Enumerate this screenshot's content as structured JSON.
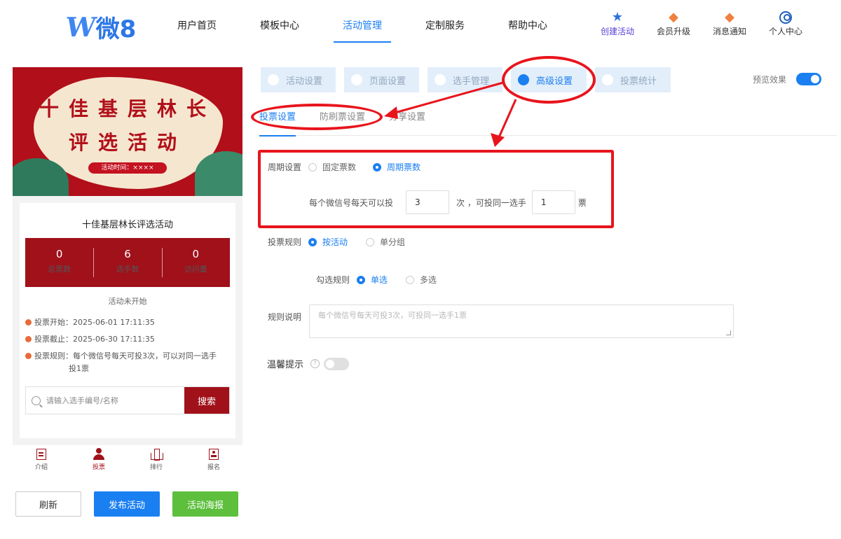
{
  "header": {
    "logo_text": "微8",
    "nav": [
      "用户首页",
      "模板中心",
      "活动管理",
      "定制服务",
      "帮助中心"
    ],
    "active_nav": "活动管理",
    "icons": [
      {
        "label": "创建活动",
        "icon": "star-icon"
      },
      {
        "label": "会员升级",
        "icon": "shield-icon"
      },
      {
        "label": "消息通知",
        "icon": "bell-shield-icon"
      },
      {
        "label": "个人中心",
        "icon": "user-icon"
      }
    ]
  },
  "preview": {
    "banner": {
      "line1": "十佳基层林长",
      "line2": "评选活动",
      "time": "活动时间：××××"
    },
    "title": "十佳基层林长评选活动",
    "stats": [
      {
        "value": "0",
        "label": "总票数"
      },
      {
        "value": "6",
        "label": "选手数"
      },
      {
        "value": "0",
        "label": "访问量"
      }
    ],
    "status": "活动未开始",
    "info": {
      "start": "投票开始：2025-06-01 17:11:35",
      "end": "投票截止：2025-06-30 17:11:35",
      "rule_line1": "投票规则：每个微信号每天可投3次，可以对同一选手",
      "rule_line2": "投1票"
    },
    "search_placeholder": "请输入选手编号/名称",
    "search_button": "搜索",
    "tabs": [
      "介绍",
      "投票",
      "排行",
      "报名"
    ],
    "active_tab": "投票"
  },
  "actions": {
    "refresh": "刷新",
    "publish": "发布活动",
    "poster": "活动海报"
  },
  "settings": {
    "steps": [
      "活动设置",
      "页面设置",
      "选手管理",
      "高级设置",
      "投票统计"
    ],
    "active_step": "高级设置",
    "preview_label": "预览效果",
    "preview_on": true,
    "subtabs": [
      "投票设置",
      "防刷票设置",
      "分享设置"
    ],
    "active_subtab": "投票设置",
    "period": {
      "label": "周期设置",
      "options": [
        "固定票数",
        "周期票数"
      ],
      "selected": "周期票数",
      "text_before": "每个微信号每天可以投",
      "times_value": "3",
      "text_middle": "次 ，可投同一选手",
      "votes_value": "1",
      "text_after": "票"
    },
    "vote_rule": {
      "label": "投票规则",
      "options": [
        "按活动",
        "单分组"
      ],
      "selected": "按活动"
    },
    "check_rule": {
      "label": "勾选规则",
      "options": [
        "单选",
        "多选"
      ],
      "selected": "单选"
    },
    "rule_desc": {
      "label": "规则说明",
      "placeholder": "每个微信号每天可投3次，可投同一选手1票"
    },
    "tip": {
      "label": "温馨提示",
      "enabled": false
    }
  },
  "colors": {
    "accent": "#1a7ff1",
    "brand_red": "#a0111a",
    "annotation": "#e8141c",
    "green": "#5dbf3c"
  }
}
